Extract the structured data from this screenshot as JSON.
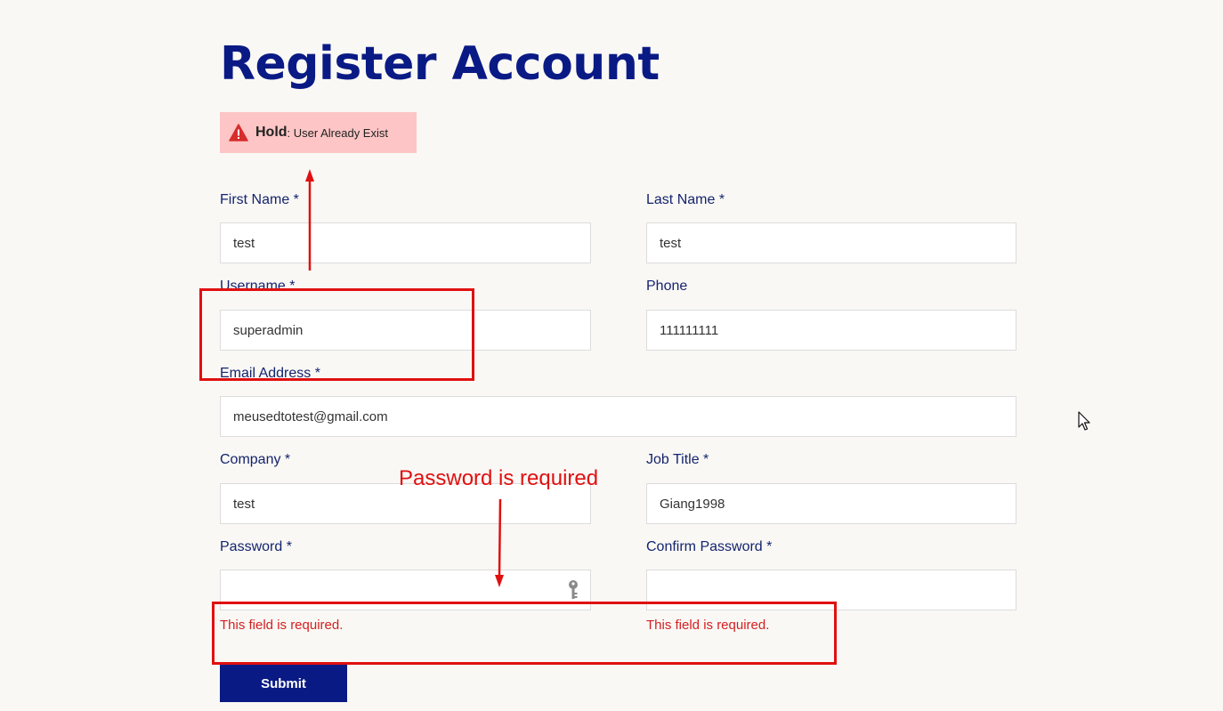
{
  "page": {
    "title": "Register Account"
  },
  "alert": {
    "label": "Hold",
    "message": ": User Already Exist",
    "icon": "warning-icon"
  },
  "form": {
    "first_name": {
      "label": "First Name *",
      "value": "test"
    },
    "last_name": {
      "label": "Last Name *",
      "value": "test"
    },
    "username": {
      "label": "Username *",
      "value": "superadmin"
    },
    "phone": {
      "label": "Phone",
      "value": "111111111"
    },
    "email": {
      "label": "Email Address *",
      "value": "meusedtotest@gmail.com"
    },
    "company": {
      "label": "Company *",
      "value": "test"
    },
    "job_title": {
      "label": "Job Title *",
      "value": "Giang1998"
    },
    "password": {
      "label": "Password *",
      "value": "",
      "error": "This field is required.",
      "icon": "key-icon"
    },
    "confirm_password": {
      "label": "Confirm Password *",
      "value": "",
      "error": "This field is required."
    },
    "submit_label": "Submit"
  },
  "annotation": {
    "text": "Password is required"
  },
  "colors": {
    "brand": "#0a1a85",
    "alert_bg": "#fdc5c5",
    "error": "#d41f1f",
    "annotation": "#e01010",
    "background": "#f9f8f5"
  }
}
